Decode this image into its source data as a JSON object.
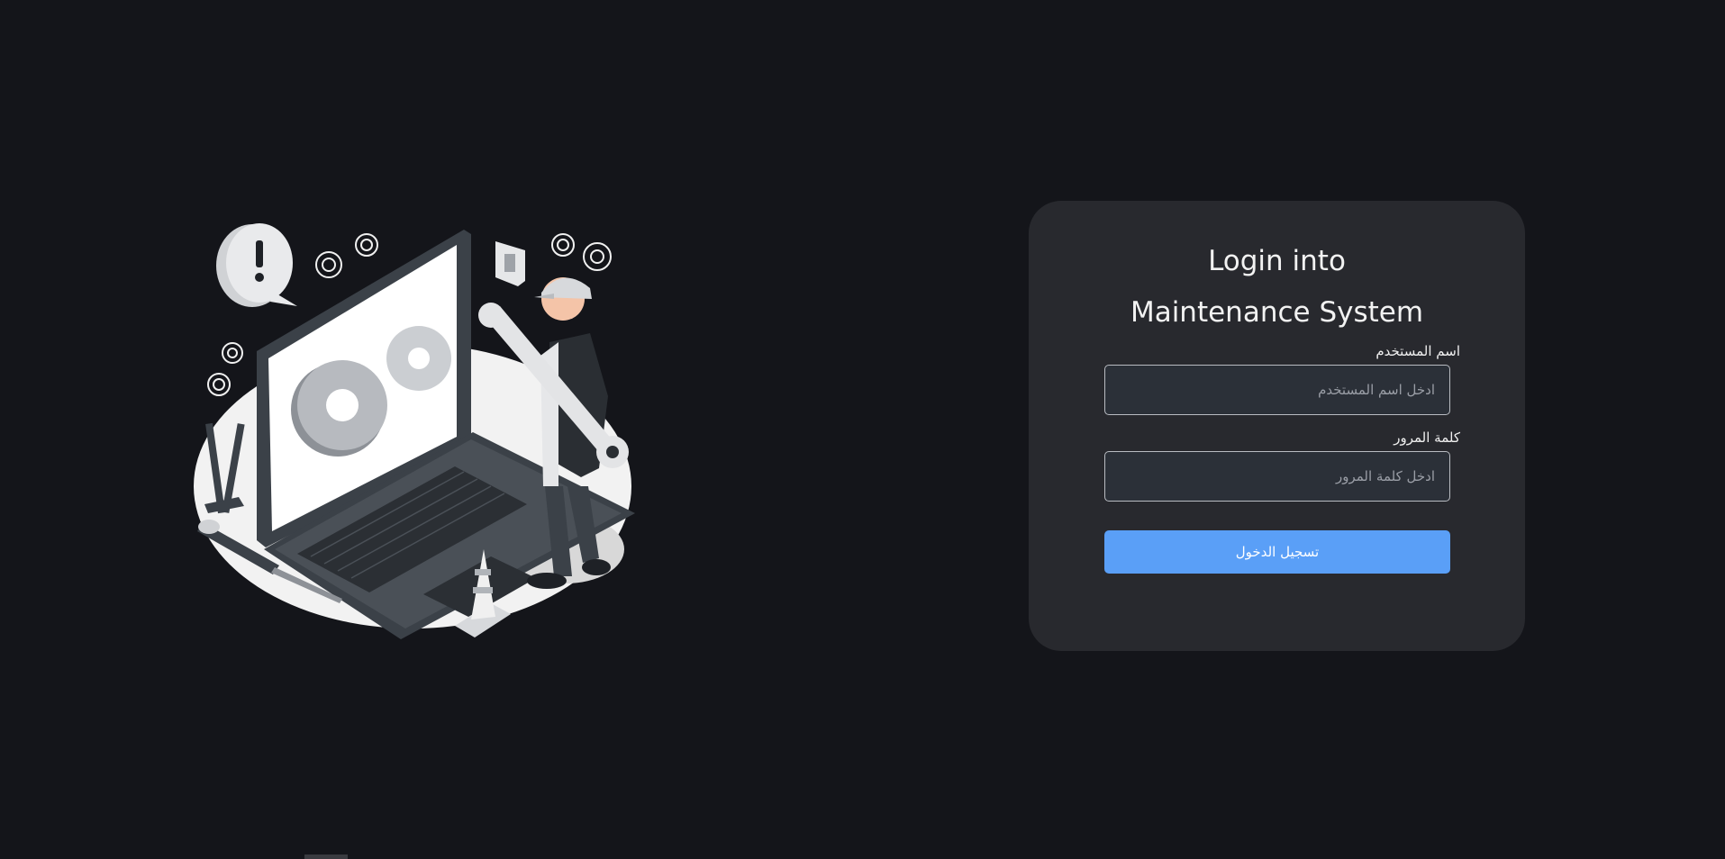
{
  "login": {
    "title_line1": "Login into",
    "title_line2": "Maintenance System",
    "username_label": "اسم المستخدم",
    "username_placeholder": "ادخل اسم المستخدم",
    "password_label": "كلمة المرور",
    "password_placeholder": "ادخل كلمة المرور",
    "submit_label": "تسجيل الدخول"
  },
  "illustration": {
    "icons": [
      "laptop-icon",
      "gear-icon",
      "wrench-icon",
      "warning-icon",
      "traffic-cone-icon",
      "screwdriver-icon",
      "mechanic-figure"
    ]
  },
  "colors": {
    "background": "#14151a",
    "card": "#28292e",
    "accent": "#5a9ff7"
  }
}
